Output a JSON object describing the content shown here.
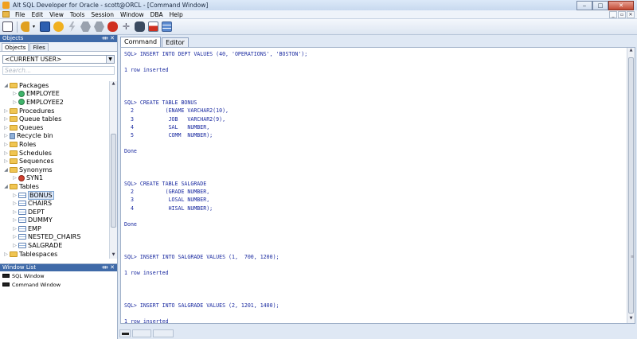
{
  "window": {
    "title": "Alt SQL Developer for Oracle - scott@ORCL - [Command Window]",
    "controls": {
      "minimize": "‒",
      "maximize": "□",
      "close": "✕"
    }
  },
  "menu": {
    "items": [
      "File",
      "Edit",
      "View",
      "Tools",
      "Session",
      "Window",
      "DBA",
      "Help"
    ],
    "mdi_controls": [
      "_",
      "▫",
      "✕"
    ]
  },
  "toolbar": {
    "icons": [
      "new-document-icon",
      "key-icon",
      "dropdown-icon",
      "save-icon",
      "sun-icon",
      "lightning-icon",
      "hexagon-icon",
      "hexagon-icon",
      "bug-icon",
      "move-icon",
      "binoculars-icon",
      "export-icon",
      "stack-icon"
    ],
    "colors": {
      "key": "#e0a020",
      "save": "#2d5fb0",
      "sun": "#f0b020",
      "bug": "#d03020"
    }
  },
  "objects_panel": {
    "title": "Objects",
    "header_buttons": "ᚓ ✕",
    "subtabs": [
      "Objects",
      "Files"
    ],
    "active_subtab": "Objects",
    "user_select": "<CURRENT USER>",
    "search_placeholder": "Search..."
  },
  "tree": [
    {
      "label": "Packages",
      "icon": "folder",
      "expanded": true,
      "depth": 0
    },
    {
      "label": "EMPLOYEE",
      "icon": "package",
      "depth": 1
    },
    {
      "label": "EMPLOYEE2",
      "icon": "package",
      "depth": 1
    },
    {
      "label": "Procedures",
      "icon": "folder",
      "depth": 0
    },
    {
      "label": "Queue tables",
      "icon": "folder",
      "depth": 0
    },
    {
      "label": "Queues",
      "icon": "folder",
      "depth": 0
    },
    {
      "label": "Recycle bin",
      "icon": "recycle-bin",
      "depth": 0
    },
    {
      "label": "Roles",
      "icon": "folder",
      "depth": 0
    },
    {
      "label": "Schedules",
      "icon": "folder",
      "depth": 0
    },
    {
      "label": "Sequences",
      "icon": "folder",
      "depth": 0
    },
    {
      "label": "Synonyms",
      "icon": "folder",
      "expanded": true,
      "depth": 0
    },
    {
      "label": "SYN1",
      "icon": "synonym",
      "depth": 1
    },
    {
      "label": "Tables",
      "icon": "folder",
      "expanded": true,
      "depth": 0
    },
    {
      "label": "BONUS",
      "icon": "table",
      "depth": 1,
      "selected": true
    },
    {
      "label": "CHAIRS",
      "icon": "table",
      "depth": 1
    },
    {
      "label": "DEPT",
      "icon": "table",
      "depth": 1
    },
    {
      "label": "DUMMY",
      "icon": "table",
      "depth": 1
    },
    {
      "label": "EMP",
      "icon": "table",
      "depth": 1
    },
    {
      "label": "NESTED_CHAIRS",
      "icon": "table",
      "depth": 1
    },
    {
      "label": "SALGRADE",
      "icon": "table",
      "depth": 1
    },
    {
      "label": "Tablespaces",
      "icon": "folder",
      "depth": 0
    }
  ],
  "window_list": {
    "title": "Window List",
    "header_buttons": "ᚓ ✕",
    "items": [
      "SQL Window",
      "Command Window"
    ]
  },
  "doc_tabs": [
    "Command",
    "Editor"
  ],
  "active_doc_tab": "Command",
  "console": [
    "SQL> INSERT INTO DEPT VALUES (40, 'OPERATIONS', 'BOSTON');",
    "",
    "1 row inserted",
    "",
    "",
    "",
    "SQL> CREATE TABLE BONUS",
    "  2          (ENAME VARCHAR2(10),",
    "  3           JOB   VARCHAR2(9),",
    "  4           SAL   NUMBER,",
    "  5           COMM  NUMBER);",
    "",
    "Done",
    "",
    "",
    "",
    "SQL> CREATE TABLE SALGRADE",
    "  2          (GRADE NUMBER,",
    "  3           LOSAL NUMBER,",
    "  4           HISAL NUMBER);",
    "",
    "Done",
    "",
    "",
    "",
    "SQL> INSERT INTO SALGRADE VALUES (1,  700, 1200);",
    "",
    "1 row inserted",
    "",
    "",
    "",
    "SQL> INSERT INTO SALGRADE VALUES (2, 1201, 1400);",
    "",
    "1 row inserted"
  ]
}
